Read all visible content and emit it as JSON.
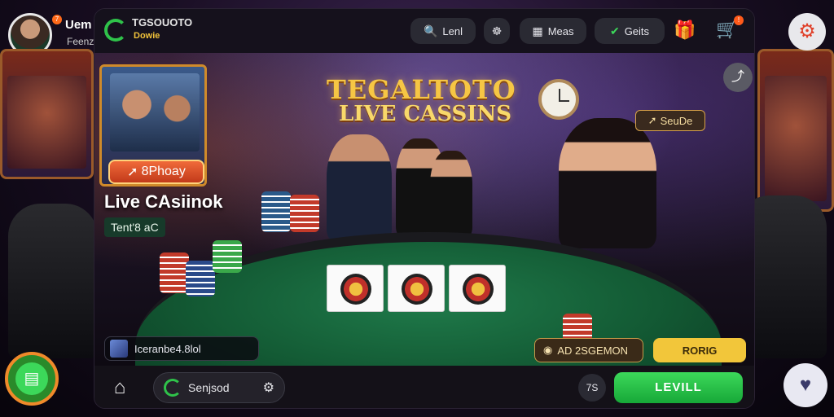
{
  "profile": {
    "name": "Uem",
    "sub": "Feenz",
    "badge": "7"
  },
  "brand": {
    "name": "TGSOUOTO",
    "sub": "Dowie"
  },
  "topbar": {
    "login_label": "Lenl",
    "promo_label": "Meas",
    "verify_label": "Geits",
    "cart_badge": "!"
  },
  "hero": {
    "title_line1": "TEGALTOTO",
    "title_line2": "LIVE CASSINS",
    "promo_button": "8Phoay",
    "live_title": "Live CAsiinok",
    "live_sub": "Tent'8 aC",
    "dealer_badge": "SeuDe",
    "live_status": "Iceranbe4.8lol",
    "bet_stat_1": "AD 2SGEMON",
    "bet_stat_2": "RORIG"
  },
  "bottombar": {
    "search_label": "Senjsod",
    "count_label": "7S",
    "level_button": "LEVILL"
  },
  "colors": {
    "accent_green": "#2fc24a",
    "gold": "#f6c644",
    "table_green": "#1f7a4a"
  }
}
